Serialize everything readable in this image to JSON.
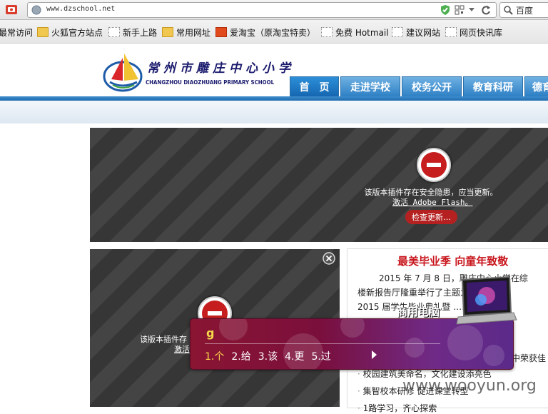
{
  "browser": {
    "url": "www.dzschool.net",
    "search_engine": "百度"
  },
  "bookmarks": [
    {
      "label": "最常访问",
      "icon": "none"
    },
    {
      "label": "火狐官方站点",
      "icon": "folder-icon"
    },
    {
      "label": "新手上路",
      "icon": "page-icon"
    },
    {
      "label": "常用网址",
      "icon": "folder-icon"
    },
    {
      "label": "爱淘宝（原淘宝特卖）",
      "icon": "taobao-icon"
    },
    {
      "label": "免费 Hotmail",
      "icon": "page-icon"
    },
    {
      "label": "建议网站",
      "icon": "page-icon"
    },
    {
      "label": "网页快讯库",
      "icon": "page-icon"
    }
  ],
  "site": {
    "name_cn": "常州市雕庄中心小学",
    "name_en": "CHANGZHOU DIAOZHUANG PRIMARY SCHOOL",
    "nav": [
      "首　页",
      "走进学校",
      "校务公开",
      "教育科研",
      "德育"
    ]
  },
  "flash": {
    "message": "该版本插件存在安全隐患，应当更新。",
    "activate_link": "激活 Adobe Flash。",
    "check_button": "检查更新…",
    "message_partial": "该版本插件存",
    "activate_partial": "激活"
  },
  "news": {
    "title": "最美毕业季 向童年致敬",
    "lines": [
      "2015 年 7 月 8 日，雕庄中心小学在综",
      "楼新报告厅隆重举行了主题为 -- 向童",
      "2015 届学生毕业典礼暨 ……[",
      "中荣获佳",
      "校园建筑美命名，文化建设添亮色",
      "集智校本研修 促进课堂转型",
      "1路学习，齐心探索"
    ]
  },
  "ime": {
    "input": "g",
    "candidates": [
      "1.个",
      "2.给",
      "3.该",
      "4.更",
      "5.过"
    ],
    "ad_label": "商用电脑"
  },
  "watermark": "www.wooyun.org",
  "colors": {
    "nav_blue": "#2c7fc4",
    "news_title_red": "#c8161d",
    "flash_red": "#c61e1e"
  }
}
